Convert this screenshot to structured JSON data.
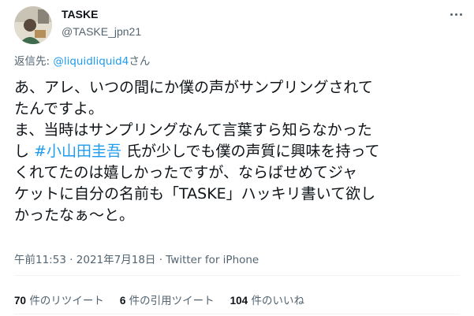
{
  "author": {
    "display_name": "TASKE",
    "handle": "@TASKE_jpn21"
  },
  "reply": {
    "prefix": "返信先: ",
    "mention": "@liquidliquid4",
    "suffix": "さん"
  },
  "tweet": {
    "lines": [
      "あ、アレ、いつの間にか僕の声がサンプリングされて",
      "たんですよ。",
      "ま、当時はサンプリングなんて言葉すら知らなかった"
    ],
    "line4_pre": "し ",
    "hashtag": "#小山田圭吾",
    "line4_post": " 氏が少しでも僕の声質に興味を持って",
    "lines_rest": [
      "くれてたのは嬉しかったですが、ならばせめてジャ",
      "ケットに自分の名前も「TASKE」ハッキリ書いて欲し",
      "かったなぁ〜と。"
    ]
  },
  "meta": {
    "time": "午前11:53",
    "separator": " · ",
    "date": "2021年7月18日",
    "source": "Twitter for iPhone"
  },
  "stats": {
    "retweets_count": "70",
    "retweets_label": " 件のリツイート",
    "quotes_count": "6",
    "quotes_label": " 件の引用ツイート",
    "likes_count": "104",
    "likes_label": " 件のいいね"
  }
}
